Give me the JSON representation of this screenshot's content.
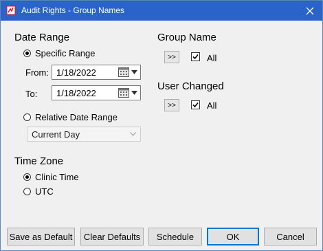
{
  "window": {
    "title": "Audit Rights - Group Names"
  },
  "date_range": {
    "title": "Date Range",
    "specific_label": "Specific Range",
    "from_label": "From:",
    "from_value": "1/18/2022",
    "to_label": "To:",
    "to_value": "1/18/2022",
    "relative_label": "Relative Date Range",
    "relative_selected": "Current Day"
  },
  "time_zone": {
    "title": "Time Zone",
    "clinic_label": "Clinic Time",
    "utc_label": "UTC"
  },
  "group_name": {
    "title": "Group Name",
    "button": ">>",
    "all_label": "All"
  },
  "user_changed": {
    "title": "User Changed",
    "button": ">>",
    "all_label": "All"
  },
  "buttons": {
    "save_default": "Save as Default",
    "clear_defaults": "Clear Defaults",
    "schedule": "Schedule",
    "ok": "OK",
    "cancel": "Cancel"
  }
}
